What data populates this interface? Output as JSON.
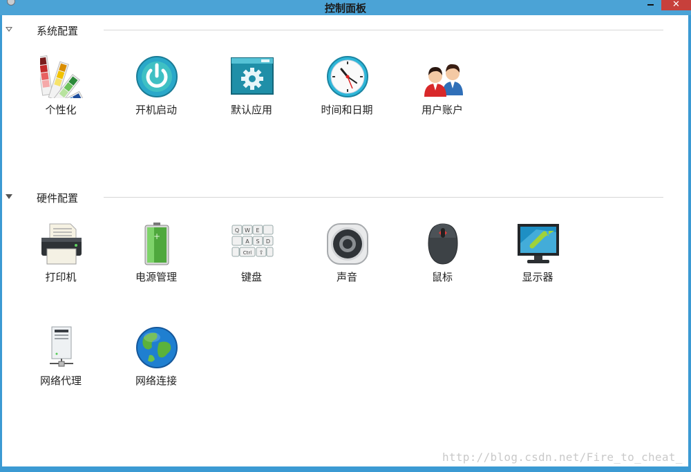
{
  "window": {
    "title": "控制面板",
    "minimize_label": "",
    "close_label": "✕"
  },
  "sections": [
    {
      "title": "系统配置",
      "items": [
        {
          "label": "个性化",
          "icon": "palette-icon"
        },
        {
          "label": "开机启动",
          "icon": "power-icon"
        },
        {
          "label": "默认应用",
          "icon": "window-gear-icon"
        },
        {
          "label": "时间和日期",
          "icon": "clock-icon"
        },
        {
          "label": "用户账户",
          "icon": "users-icon"
        }
      ]
    },
    {
      "title": "硬件配置",
      "items": [
        {
          "label": "打印机",
          "icon": "printer-icon"
        },
        {
          "label": "电源管理",
          "icon": "battery-icon"
        },
        {
          "label": "键盘",
          "icon": "keyboard-icon"
        },
        {
          "label": "声音",
          "icon": "speaker-icon"
        },
        {
          "label": "鼠标",
          "icon": "mouse-icon"
        },
        {
          "label": "显示器",
          "icon": "monitor-icon"
        },
        {
          "label": "网络代理",
          "icon": "network-server-icon"
        },
        {
          "label": "网络连接",
          "icon": "globe-icon"
        }
      ]
    }
  ],
  "watermark": "http://blog.csdn.net/Fire_to_cheat_",
  "colors": {
    "title_bar": "#4ba3d6",
    "close_button": "#c7403b",
    "background": "#ffffff"
  }
}
